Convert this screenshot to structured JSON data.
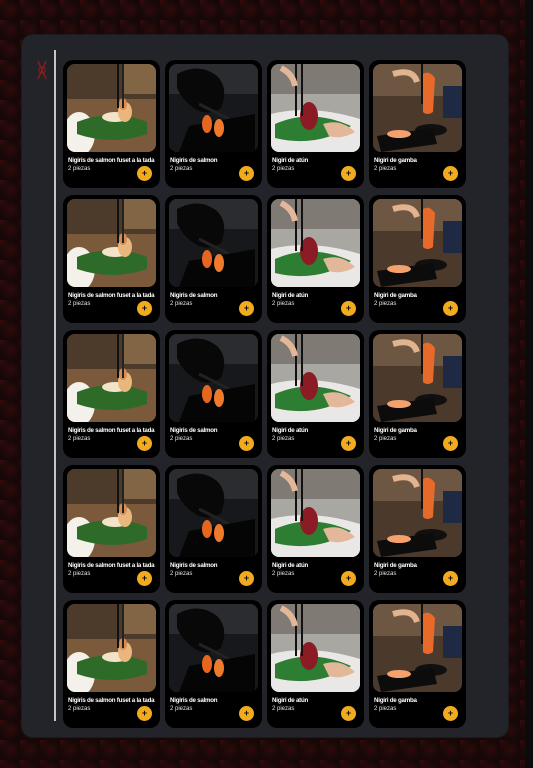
{
  "products": [
    {
      "name": "Nigiris de salmon  fuset a la tada",
      "qty": "2 piezas",
      "add_label": "+",
      "variant": "torch"
    },
    {
      "name": "Nigiris de salmon",
      "qty": "2 piezas",
      "add_label": "+",
      "variant": "glove"
    },
    {
      "name": "Nigiri de atún",
      "qty": "2 piezas",
      "add_label": "+",
      "variant": "tuna"
    },
    {
      "name": "Nigiri de gamba",
      "qty": "2 piezas",
      "add_label": "+",
      "variant": "shrimp"
    },
    {
      "name": "Nigiris de salmon  fuset a la tada",
      "qty": "2 piezas",
      "add_label": "+",
      "variant": "torch"
    },
    {
      "name": "Nigiris de salmon",
      "qty": "2 piezas",
      "add_label": "+",
      "variant": "glove"
    },
    {
      "name": "Nigiri de atún",
      "qty": "2 piezas",
      "add_label": "+",
      "variant": "tuna"
    },
    {
      "name": "Nigiri de gamba",
      "qty": "2 piezas",
      "add_label": "+",
      "variant": "shrimp"
    },
    {
      "name": "Nigiris de salmon  fuset a la tada",
      "qty": "2 piezas",
      "add_label": "+",
      "variant": "torch"
    },
    {
      "name": "Nigiris de salmon",
      "qty": "2 piezas",
      "add_label": "+",
      "variant": "glove"
    },
    {
      "name": "Nigiri de atún",
      "qty": "2 piezas",
      "add_label": "+",
      "variant": "tuna"
    },
    {
      "name": "Nigiri de gamba",
      "qty": "2 piezas",
      "add_label": "+",
      "variant": "shrimp"
    },
    {
      "name": "Nigiris de salmon  fuset a la tada",
      "qty": "2 piezas",
      "add_label": "+",
      "variant": "torch"
    },
    {
      "name": "Nigiris de salmon",
      "qty": "2 piezas",
      "add_label": "+",
      "variant": "glove"
    },
    {
      "name": "Nigiri de atún",
      "qty": "2 piezas",
      "add_label": "+",
      "variant": "tuna"
    },
    {
      "name": "Nigiri de gamba",
      "qty": "2 piezas",
      "add_label": "+",
      "variant": "shrimp"
    },
    {
      "name": "Nigiris de salmon  fuset a la tada",
      "qty": "2 piezas",
      "add_label": "+",
      "variant": "torch"
    },
    {
      "name": "Nigiris de salmon",
      "qty": "2 piezas",
      "add_label": "+",
      "variant": "glove"
    },
    {
      "name": "Nigiri de atún",
      "qty": "2 piezas",
      "add_label": "+",
      "variant": "tuna"
    },
    {
      "name": "Nigiri de gamba",
      "qty": "2 piezas",
      "add_label": "+",
      "variant": "shrimp"
    }
  ],
  "icons": {
    "sidebar": "chopsticks-icon",
    "add": "plus-icon"
  },
  "colors": {
    "accent": "#f2ab1c",
    "panel": "#22242a",
    "card": "#000000",
    "background": "#160808"
  }
}
